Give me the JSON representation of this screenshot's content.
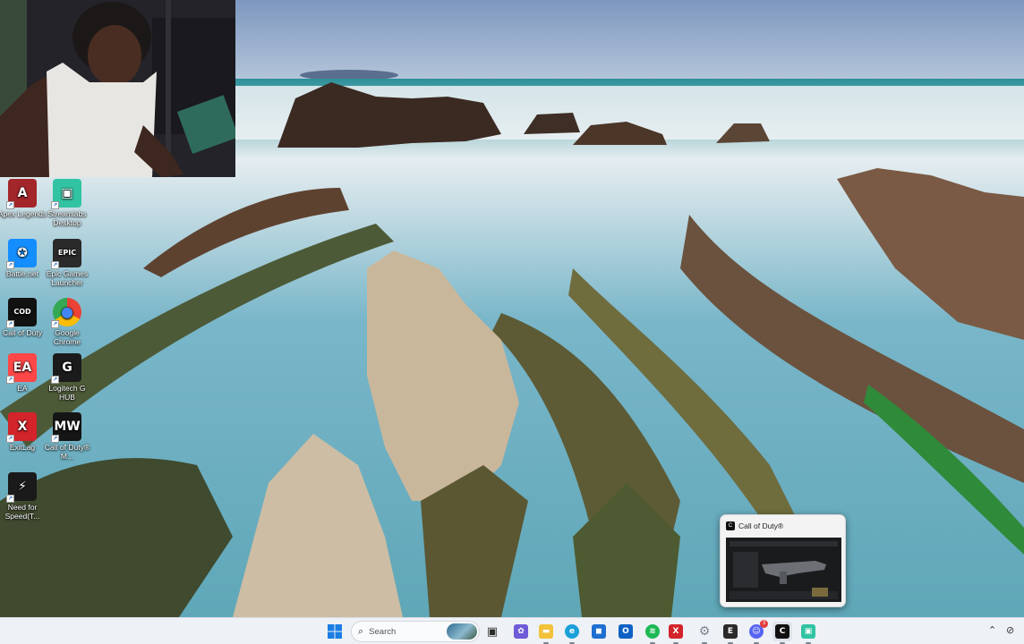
{
  "desktop": {
    "icons": [
      {
        "label": "Apex Legends",
        "icon": "apex-legends-icon",
        "color": "#a3262b",
        "glyph": "A"
      },
      {
        "label": "Streamlabs Desktop",
        "icon": "streamlabs-icon",
        "color": "#31c3a2",
        "glyph": "▣"
      },
      {
        "label": "Battle.net",
        "icon": "battlenet-icon",
        "color": "#148eff",
        "glyph": "✪"
      },
      {
        "label": "Epic Games Launcher",
        "icon": "epic-games-icon",
        "color": "#2a2a2a",
        "glyph": "EPIC"
      },
      {
        "label": "Call of Duty",
        "icon": "call-of-duty-icon",
        "color": "#111111",
        "glyph": "COD"
      },
      {
        "label": "Google Chrome",
        "icon": "chrome-icon",
        "color": "#ffffff",
        "glyph": "●"
      },
      {
        "label": "EA",
        "icon": "ea-icon",
        "color": "#ff4747",
        "glyph": "EA"
      },
      {
        "label": "Logitech G HUB",
        "icon": "logitech-ghub-icon",
        "color": "#1b1b1b",
        "glyph": "G"
      },
      {
        "label": "ExitLag",
        "icon": "exitlag-icon",
        "color": "#d3232b",
        "glyph": "X"
      },
      {
        "label": "Call of Duty® M...",
        "icon": "mwiii-icon",
        "color": "#151515",
        "glyph": "MW"
      },
      {
        "label": "Need for Speed(T...",
        "icon": "need-for-speed-icon",
        "color": "#1a1a1a",
        "glyph": "⚡"
      }
    ]
  },
  "thumbnail": {
    "title": "Call of Duty®"
  },
  "taskbar": {
    "search_placeholder": "Search",
    "items": [
      {
        "name": "start",
        "icon": "windows-start-icon",
        "color": "#0a68d8",
        "glyph": "⊞"
      },
      {
        "name": "task-view",
        "icon": "task-view-icon",
        "color": "#2b2b2b",
        "glyph": "▣"
      },
      {
        "name": "copilot",
        "icon": "copilot-icon",
        "color": "#6d5bd8",
        "glyph": "✿"
      },
      {
        "name": "file-explorer",
        "icon": "folder-icon",
        "color": "#f2c23b",
        "glyph": "▬"
      },
      {
        "name": "edge",
        "icon": "edge-icon",
        "color": "#1aa0d8",
        "glyph": "e"
      },
      {
        "name": "store",
        "icon": "store-icon",
        "color": "#1f6fd1",
        "glyph": "◼"
      },
      {
        "name": "outlook",
        "icon": "outlook-icon",
        "color": "#0f62c4",
        "glyph": "O"
      },
      {
        "name": "spotify",
        "icon": "spotify-icon",
        "color": "#1db954",
        "glyph": "≋"
      },
      {
        "name": "exitlag",
        "icon": "exitlag-icon",
        "color": "#d3232b",
        "glyph": "X"
      },
      {
        "name": "settings",
        "icon": "gear-icon",
        "color": "#7a8591",
        "glyph": "⚙"
      },
      {
        "name": "epic",
        "icon": "epic-games-icon",
        "color": "#2a2a2a",
        "glyph": "E"
      },
      {
        "name": "discord",
        "icon": "discord-icon",
        "color": "#5865f2",
        "glyph": "☺"
      },
      {
        "name": "call-of-duty",
        "icon": "call-of-duty-icon",
        "color": "#111111",
        "glyph": "C"
      },
      {
        "name": "streamlabs",
        "icon": "streamlabs-icon",
        "color": "#31c3a2",
        "glyph": "▣"
      }
    ],
    "discord_badge": "3"
  }
}
